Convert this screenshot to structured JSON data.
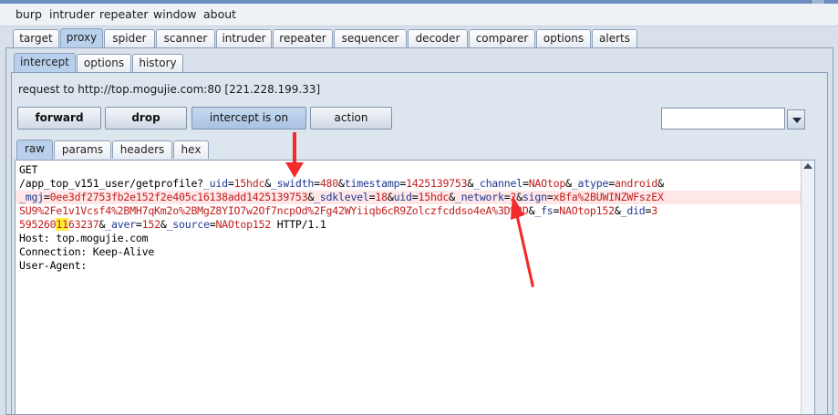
{
  "menu": [
    "burp",
    "intruder",
    "repeater",
    "window",
    "about"
  ],
  "main_tabs": [
    "target",
    "proxy",
    "spider",
    "scanner",
    "intruder",
    "repeater",
    "sequencer",
    "decoder",
    "comparer",
    "options",
    "alerts"
  ],
  "main_active": "proxy",
  "proxy_tabs": [
    "intercept",
    "options",
    "history"
  ],
  "proxy_active": "intercept",
  "request_info": "request to http://top.mogujie.com:80  [221.228.199.33]",
  "buttons": {
    "forward": "forward",
    "drop": "drop",
    "intercept": "intercept is on",
    "action": "action"
  },
  "combo_value": "",
  "view_tabs": [
    "raw",
    "params",
    "headers",
    "hex"
  ],
  "view_active": "raw",
  "request": {
    "method": "GET",
    "path": "/app_top_v151_user/getprofile?",
    "query_line1": [
      [
        "_uid",
        "15hdc"
      ],
      [
        "_swidth",
        "480"
      ],
      [
        "timestamp",
        "1425139753"
      ],
      [
        "_channel",
        "NAOtop"
      ],
      [
        "_atype",
        "android"
      ]
    ],
    "query_line2": [
      [
        "_mgj",
        "0ee3df2753fb2e152f2e405c16138add1425139753"
      ],
      [
        "_sdklevel",
        "18"
      ],
      [
        "uid",
        "15hdc"
      ],
      [
        "_network",
        "2"
      ],
      [
        "sign",
        "xBfa%2BUWINZWFszEX"
      ]
    ],
    "line3_text": "SU9%2Fe1v1Vcsf4%2BMH7qKm2o%2BMgZ8YIO7w2Of7ncpOd%2Fg42WYiiqb6cR9Zolcz",
    "line3_rest": "fcddso4eA%3D%3D",
    "line3_pairs": [
      [
        "_fs",
        "NAOtop152"
      ],
      [
        "_did",
        "3"
      ]
    ],
    "line4_pre": "595260",
    "line4_mark": "11",
    "line4_post": "63237",
    "line4_pairs": [
      [
        "_aver",
        "152"
      ],
      [
        "_source",
        "NAOtop152"
      ]
    ],
    "protocol": " HTTP/1.1",
    "headers": [
      "Host: top.mogujie.com",
      "Connection: Keep-Alive",
      "User-Agent:"
    ]
  }
}
